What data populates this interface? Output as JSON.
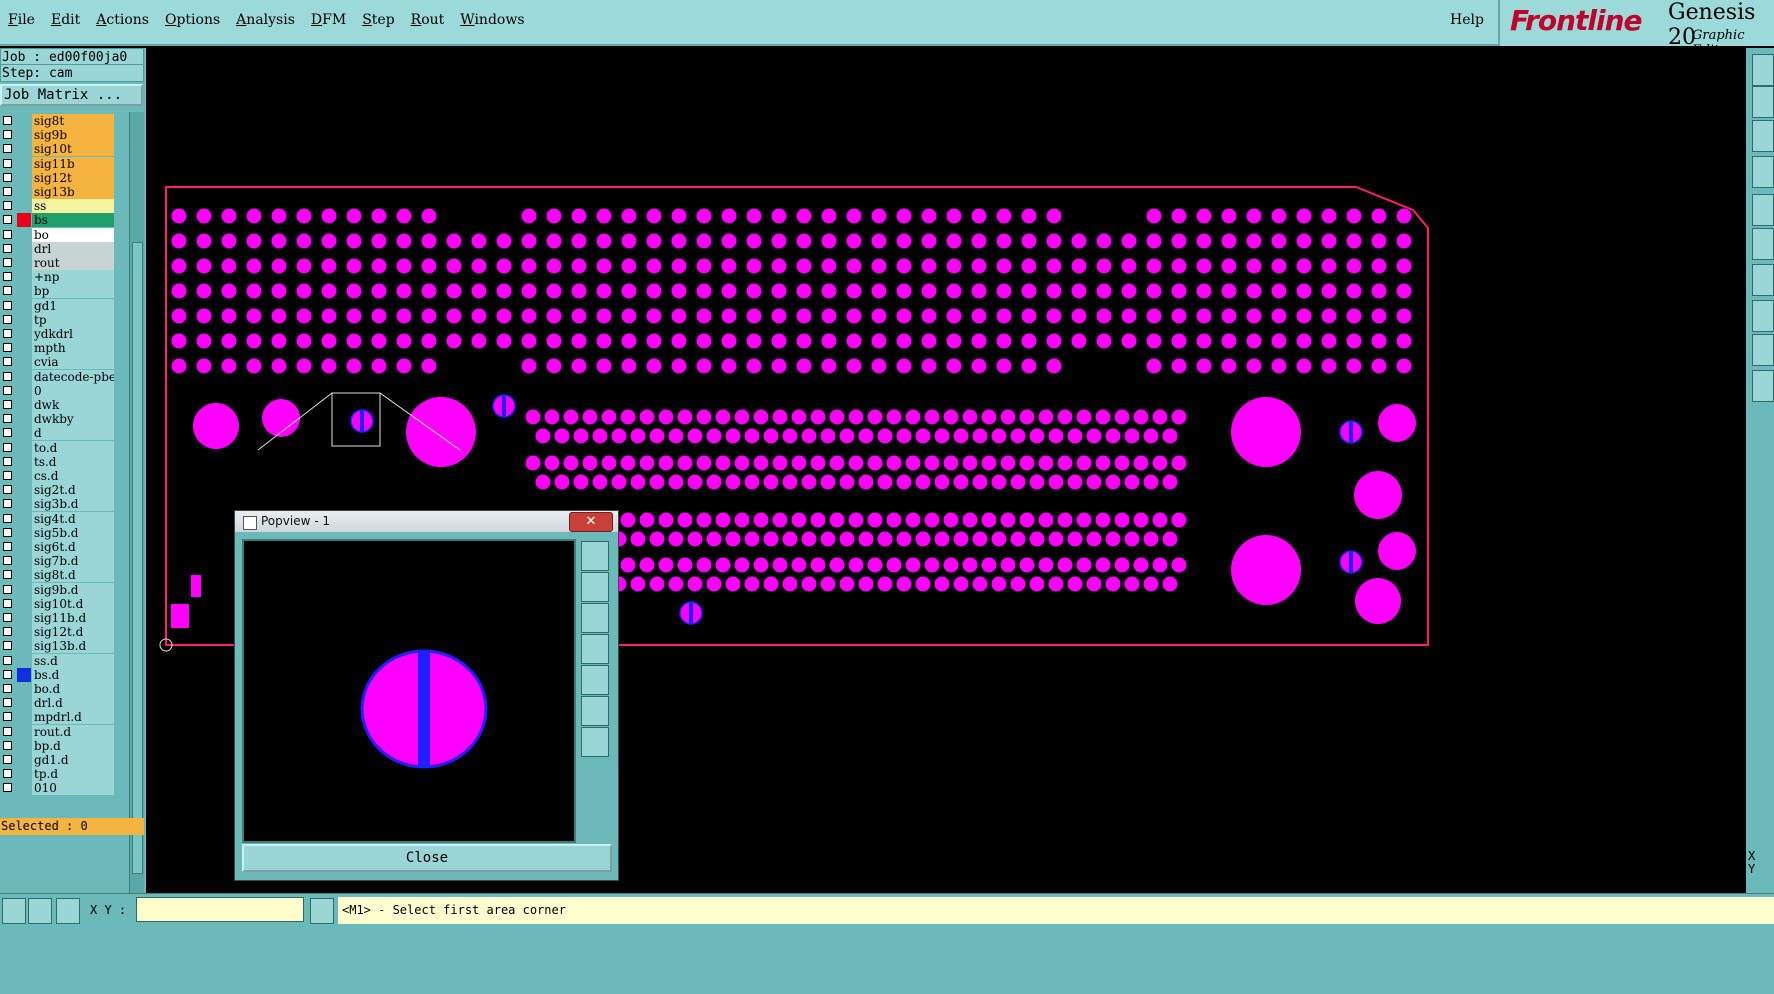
{
  "menubar": {
    "items": [
      "File",
      "Edit",
      "Actions",
      "Options",
      "Analysis",
      "DFM",
      "Step",
      "Rout",
      "Windows"
    ],
    "help": "Help"
  },
  "brand": {
    "logo": "Frontline",
    "product": "Genesis 20",
    "subtitle": "Graphic Edito"
  },
  "left_panel": {
    "job": "Job : ed00f00ja0",
    "step": "Step: cam",
    "job_matrix": "Job Matrix ...",
    "selected": "Selected : 0",
    "layers": [
      {
        "name": "sig8t",
        "color": "#f5b340"
      },
      {
        "name": "sig9b",
        "color": "#f5b340"
      },
      {
        "name": "sig10t",
        "color": "#f5b340"
      },
      {
        "name": "sig11b",
        "color": "#f5b340"
      },
      {
        "name": "sig12t",
        "color": "#f5b340"
      },
      {
        "name": "sig13b",
        "color": "#f5b340"
      },
      {
        "name": "ss",
        "color": "#f5f5a0"
      },
      {
        "name": "bs",
        "color": "#1fa06a",
        "swatch": "#e8001a"
      },
      {
        "name": "bo",
        "color": "#ffffff"
      },
      {
        "name": "drl",
        "color": "#c8d4d4"
      },
      {
        "name": "rout",
        "color": "#c8d4d4"
      },
      {
        "name": "+np",
        "color": "#9ad6d6"
      },
      {
        "name": "bp",
        "color": "#9ad6d6"
      },
      {
        "name": "gd1",
        "color": "#9ad6d6"
      },
      {
        "name": "tp",
        "color": "#9ad6d6"
      },
      {
        "name": "ydkdrl",
        "color": "#9ad6d6"
      },
      {
        "name": "mpth",
        "color": "#9ad6d6"
      },
      {
        "name": "cvia",
        "color": "#9ad6d6"
      },
      {
        "name": "datecode-pbe",
        "color": "#9ad6d6"
      },
      {
        "name": "0",
        "color": "#9ad6d6"
      },
      {
        "name": "dwk",
        "color": "#9ad6d6"
      },
      {
        "name": "dwkby",
        "color": "#9ad6d6"
      },
      {
        "name": "d",
        "color": "#9ad6d6"
      },
      {
        "name": "to.d",
        "color": "#9ad6d6"
      },
      {
        "name": "ts.d",
        "color": "#9ad6d6"
      },
      {
        "name": "cs.d",
        "color": "#9ad6d6"
      },
      {
        "name": "sig2t.d",
        "color": "#9ad6d6"
      },
      {
        "name": "sig3b.d",
        "color": "#9ad6d6"
      },
      {
        "name": "sig4t.d",
        "color": "#9ad6d6"
      },
      {
        "name": "sig5b.d",
        "color": "#9ad6d6"
      },
      {
        "name": "sig6t.d",
        "color": "#9ad6d6"
      },
      {
        "name": "sig7b.d",
        "color": "#9ad6d6"
      },
      {
        "name": "sig8t.d",
        "color": "#9ad6d6"
      },
      {
        "name": "sig9b.d",
        "color": "#9ad6d6"
      },
      {
        "name": "sig10t.d",
        "color": "#9ad6d6"
      },
      {
        "name": "sig11b.d",
        "color": "#9ad6d6"
      },
      {
        "name": "sig12t.d",
        "color": "#9ad6d6"
      },
      {
        "name": "sig13b.d",
        "color": "#9ad6d6"
      },
      {
        "name": "ss.d",
        "color": "#9ad6d6"
      },
      {
        "name": "bs.d",
        "color": "#9ad6d6",
        "swatch": "#1030e0"
      },
      {
        "name": "bo.d",
        "color": "#9ad6d6"
      },
      {
        "name": "drl.d",
        "color": "#9ad6d6"
      },
      {
        "name": "mpdrl.d",
        "color": "#9ad6d6"
      },
      {
        "name": "rout.d",
        "color": "#9ad6d6"
      },
      {
        "name": "bp.d",
        "color": "#9ad6d6"
      },
      {
        "name": "gd1.d",
        "color": "#9ad6d6"
      },
      {
        "name": "tp.d",
        "color": "#9ad6d6"
      },
      {
        "name": "010",
        "color": "#9ad6d6"
      }
    ]
  },
  "popview": {
    "title": "Popview - 1",
    "close_x": "✕",
    "close_button": "Close",
    "tool_icons": [
      "zoom-home-icon",
      "pan-up-icon",
      "pan-down-icon",
      "pan-left-icon",
      "pan-right-icon",
      "zoom-in-icon",
      "zoom-out-icon"
    ]
  },
  "bottom_bar": {
    "xy_label": "X Y :",
    "xy_value": "",
    "status": "<M1> - Select first area corner"
  },
  "right_panel": {
    "xy_readout": "X\nY"
  },
  "colors": {
    "pad": "#ff00ff",
    "outline": "#ff1e6e",
    "hole": "#2020ff",
    "panel": "#6bb9b9",
    "menubar": "#9cd9d9"
  }
}
